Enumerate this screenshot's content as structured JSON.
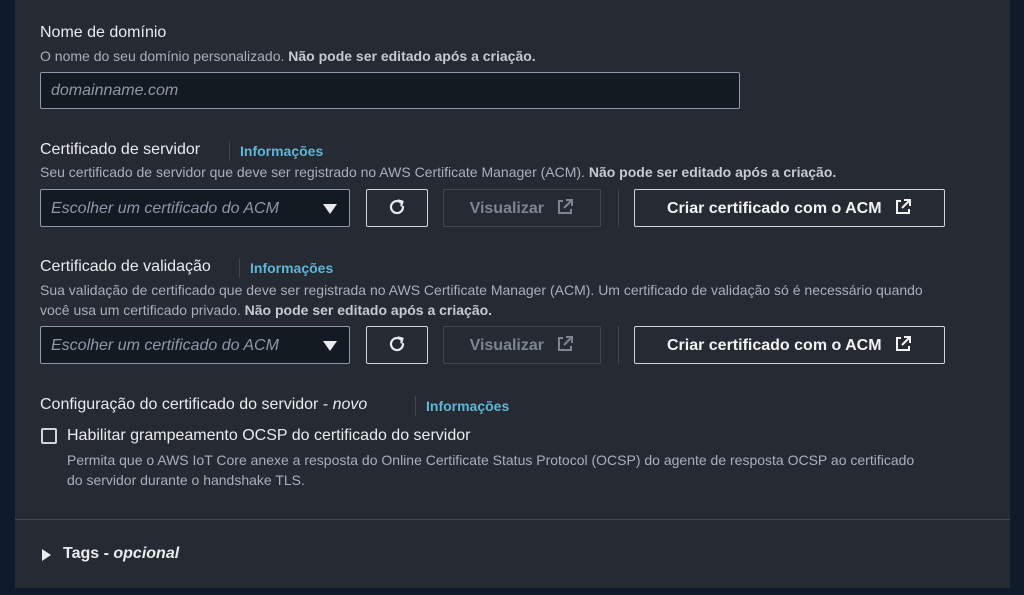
{
  "domain_name": {
    "label": "Nome de domínio",
    "desc_normal": "O nome do seu domínio personalizado. ",
    "desc_bold": "Não pode ser editado após a criação.",
    "placeholder": "domainname.com"
  },
  "server_cert": {
    "label": "Certificado de servidor",
    "info": "Informações",
    "desc_normal": "Seu certificado de servidor que deve ser registrado no AWS Certificate Manager (ACM). ",
    "desc_bold": "Não pode ser editado após a criação.",
    "select_placeholder": "Escolher um certificado do ACM",
    "view_label": "Visualizar",
    "create_label": "Criar certificado com o ACM"
  },
  "validation_cert": {
    "label": "Certificado de validação",
    "info": "Informações",
    "desc_line1": "Sua validação de certificado que deve ser registrada no AWS Certificate Manager (ACM). Um certificado de validação só é necessário quando",
    "desc_line2_normal": "você usa um certificado privado. ",
    "desc_line2_bold": "Não pode ser editado após a criação.",
    "select_placeholder": "Escolher um certificado do ACM",
    "view_label": "Visualizar",
    "create_label": "Criar certificado com o ACM"
  },
  "server_cert_config": {
    "label": "Configuração do certificado do servidor - ",
    "label_italic": "novo",
    "info": "Informações",
    "checkbox_label": "Habilitar grampeamento OCSP do certificado do servidor",
    "checkbox_checked": false,
    "checkbox_desc_line1": "Permita que o AWS IoT Core anexe a resposta do Online Certificate Status Protocol (OCSP) do agente de resposta OCSP ao certificado",
    "checkbox_desc_line2": "do servidor durante o handshake TLS."
  },
  "tags": {
    "label": "Tags - ",
    "label_italic": "opcional"
  },
  "colors": {
    "panel_bg": "#252a33",
    "info_link": "#5eb6d8",
    "text": "#e9ebed",
    "muted": "#a9b0ba"
  }
}
